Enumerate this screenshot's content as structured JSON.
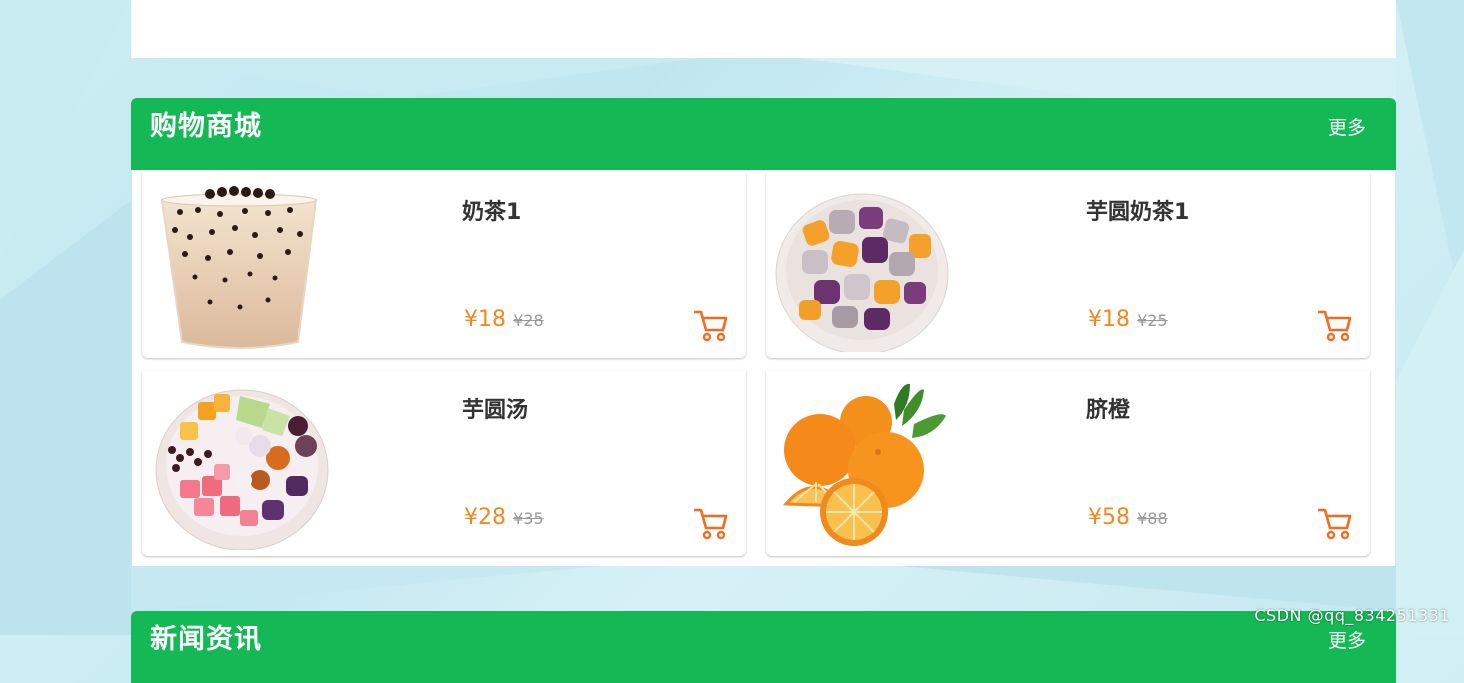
{
  "top_panel": {},
  "shop_section": {
    "title": "购物商城",
    "more_label": "更多",
    "products": [
      {
        "name": "奶茶1",
        "price": "¥18",
        "original_price": "¥28",
        "image_icon": "milk-tea-cup-image"
      },
      {
        "name": "芋圆奶茶1",
        "price": "¥18",
        "original_price": "¥25",
        "image_icon": "taro-balls-bowl-image"
      },
      {
        "name": "芋圆汤",
        "price": "¥28",
        "original_price": "¥35",
        "image_icon": "taro-ball-soup-bowl-image"
      },
      {
        "name": "脐橙",
        "price": "¥58",
        "original_price": "¥88",
        "image_icon": "navel-oranges-image"
      }
    ]
  },
  "news_section": {
    "title": "新闻资讯",
    "more_label": "更多"
  },
  "watermark": "CSDN @qq_834251331",
  "colors": {
    "header_green": "#14b955",
    "price_orange": "#f08a1e",
    "cart_orange": "#f26b22",
    "old_price_gray": "#999999"
  }
}
